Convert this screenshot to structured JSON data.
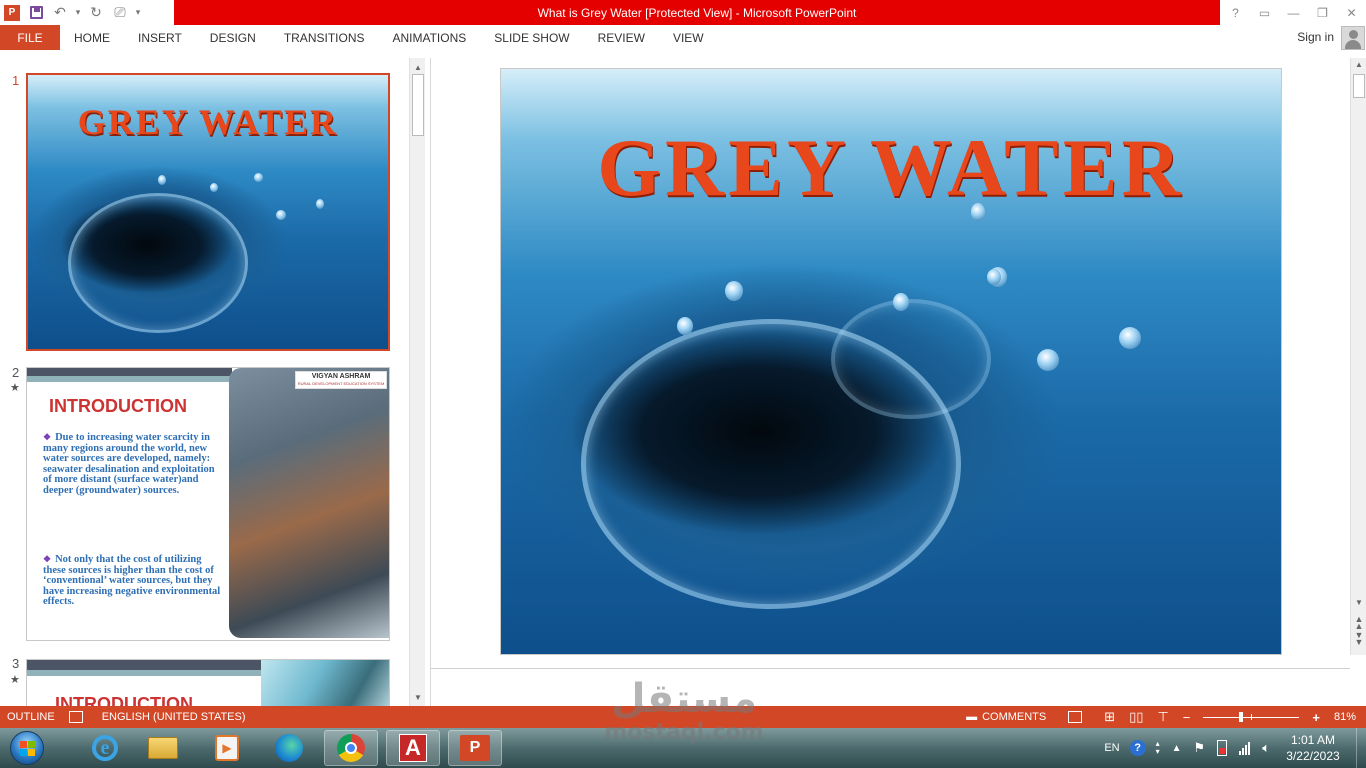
{
  "window": {
    "title": "What is Grey Water [Protected View] -  Microsoft PowerPoint",
    "controls": [
      "?",
      "restore",
      "minimize",
      "maximize",
      "close"
    ]
  },
  "ribbon": {
    "file_label": "FILE",
    "tabs": [
      "HOME",
      "INSERT",
      "DESIGN",
      "TRANSITIONS",
      "ANIMATIONS",
      "SLIDE SHOW",
      "REVIEW",
      "VIEW"
    ],
    "signin_label": "Sign in"
  },
  "thumbnails": {
    "slide1": {
      "number": "1",
      "title": "GREY  WATER"
    },
    "slide2": {
      "number": "2",
      "star": "★",
      "logo_title": "VIGYAN ASHRAM",
      "logo_sub": "RURAL DEVELOPMENT EDUCATION SYSTEM",
      "heading": "INTRODUCTION",
      "bullet1": "Due to increasing water scarcity in many regions around the world, new water sources are developed, namely: seawater desalination and exploitation of more distant (surface water)and deeper (groundwater) sources.",
      "bullet2": "Not only that the cost of utilizing these sources is higher than the cost of ‘conventional’ water sources, but they have increasing negative environmental effects."
    },
    "slide3": {
      "number": "3",
      "star": "★",
      "heading": "INTRODUCTION"
    }
  },
  "main_slide": {
    "title": "GREY  WATER"
  },
  "statusbar": {
    "outline_label": "OUTLINE",
    "language": "ENGLISH (UNITED STATES)",
    "comments_label": "COMMENTS",
    "zoom_out": "−",
    "zoom_in": "+",
    "zoom": "81%",
    "zoom_fraction": 0.81
  },
  "taskbar": {
    "apps": [
      "internet-explorer",
      "file-explorer",
      "media-player",
      "edge",
      "chrome",
      "autocad",
      "powerpoint"
    ],
    "lang": "EN",
    "time": "1:01 AM",
    "date": "3/22/2023"
  },
  "watermark": {
    "arabic": "مستقل",
    "latin": "mostaql.com"
  },
  "colors": {
    "accent": "#d24726",
    "titlebar_red": "#e50000",
    "slide_title": "#e8471c"
  }
}
